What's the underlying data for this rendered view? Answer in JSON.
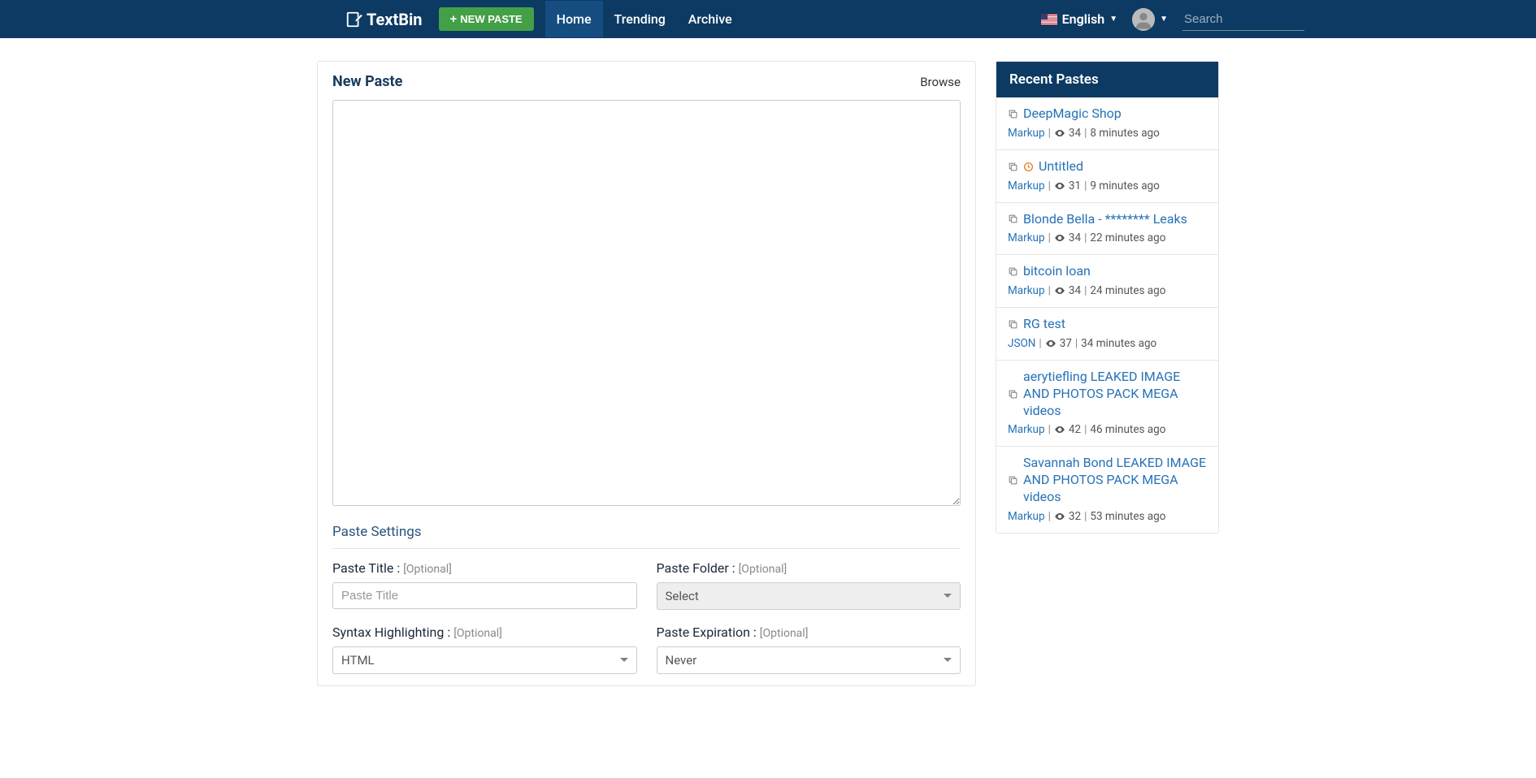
{
  "brand": "TextBin",
  "new_paste_btn": "NEW PASTE",
  "nav": {
    "home": "Home",
    "trending": "Trending",
    "archive": "Archive"
  },
  "language": "English",
  "search_placeholder": "Search",
  "main": {
    "title": "New Paste",
    "browse": "Browse",
    "settings_title": "Paste Settings",
    "fields": {
      "title_label": "Paste Title :",
      "title_placeholder": "Paste Title",
      "folder_label": "Paste Folder :",
      "folder_select": "Select",
      "syntax_label": "Syntax Highlighting :",
      "syntax_select": "HTML",
      "expire_label": "Paste Expiration :",
      "expire_select": "Never",
      "optional": "[Optional]"
    }
  },
  "sidebar": {
    "title": "Recent Pastes",
    "items": [
      {
        "title": "DeepMagic Shop",
        "lang": "Markup",
        "views": "34",
        "time": "8 minutes ago",
        "timed": false
      },
      {
        "title": "Untitled",
        "lang": "Markup",
        "views": "31",
        "time": "9 minutes ago",
        "timed": true
      },
      {
        "title": "Blonde Bella - ******** Leaks",
        "lang": "Markup",
        "views": "34",
        "time": "22 minutes ago",
        "timed": false
      },
      {
        "title": "bitcoin loan",
        "lang": "Markup",
        "views": "34",
        "time": "24 minutes ago",
        "timed": false
      },
      {
        "title": "RG test",
        "lang": "JSON",
        "views": "37",
        "time": "34 minutes ago",
        "timed": false
      },
      {
        "title": "aerytiefling LEAKED IMAGE AND PHOTOS PACK MEGA videos",
        "lang": "Markup",
        "views": "42",
        "time": "46 minutes ago",
        "timed": false
      },
      {
        "title": "Savannah Bond LEAKED IMAGE AND PHOTOS PACK MEGA videos",
        "lang": "Markup",
        "views": "32",
        "time": "53 minutes ago",
        "timed": false
      }
    ]
  }
}
